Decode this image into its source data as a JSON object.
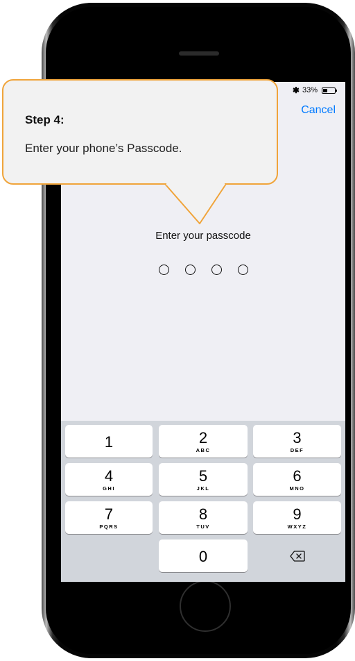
{
  "status_bar": {
    "bluetooth": "✱",
    "battery_percent": "33%",
    "battery_level": 0.33
  },
  "nav": {
    "cancel_label": "Cancel"
  },
  "passcode": {
    "prompt": "Enter your passcode",
    "digits_entered": 0,
    "length": 4
  },
  "keypad": {
    "keys": [
      {
        "num": "1",
        "letters": ""
      },
      {
        "num": "2",
        "letters": "ABC"
      },
      {
        "num": "3",
        "letters": "DEF"
      },
      {
        "num": "4",
        "letters": "GHI"
      },
      {
        "num": "5",
        "letters": "JKL"
      },
      {
        "num": "6",
        "letters": "MNO"
      },
      {
        "num": "7",
        "letters": "PQRS"
      },
      {
        "num": "8",
        "letters": "TUV"
      },
      {
        "num": "9",
        "letters": "WXYZ"
      },
      {
        "num": "0",
        "letters": ""
      }
    ],
    "delete_icon": "backspace-icon"
  },
  "callout": {
    "title": "Step 4:",
    "body": "Enter your phone’s Passcode.",
    "accent_color": "#f0a43a"
  }
}
